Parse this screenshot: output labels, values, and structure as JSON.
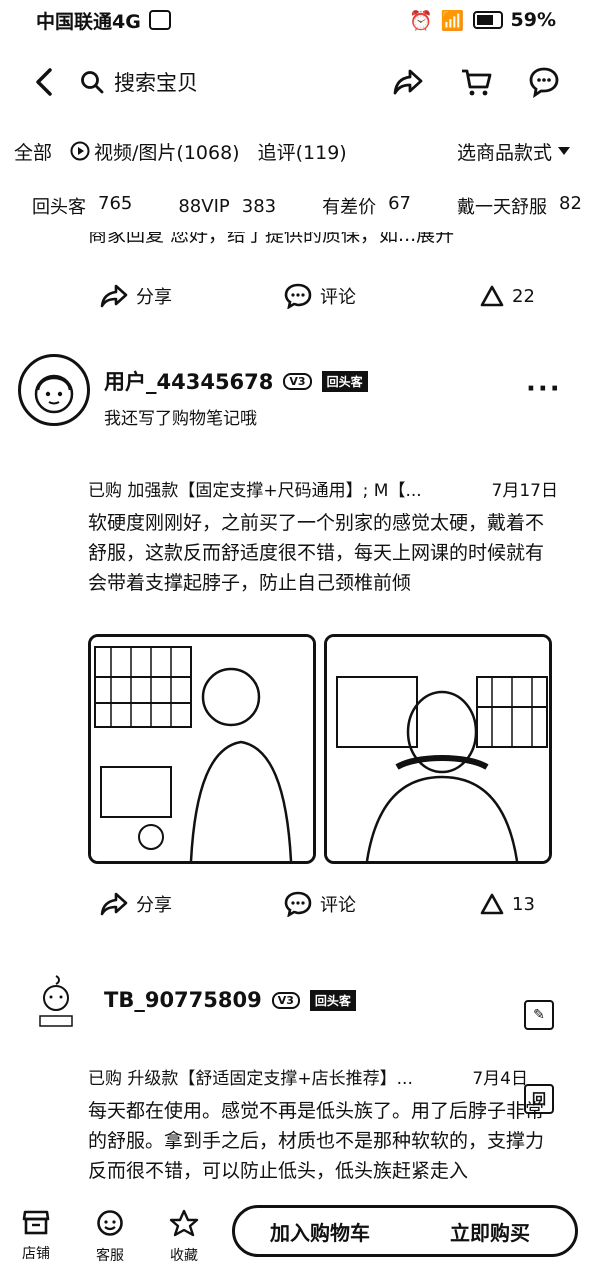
{
  "status_bar": {
    "carrier": "中国联通4G",
    "battery": "59%"
  },
  "nav": {
    "search_text": "搜索宝贝"
  },
  "filters": {
    "all": "全部",
    "media": "视频/图片(1068)",
    "followup": "追评(119)",
    "style": "选商品款式"
  },
  "tags": [
    {
      "label": "回头客",
      "count": "765"
    },
    {
      "label": "88VIP",
      "count": "383"
    },
    {
      "label": "有差价",
      "count": "67"
    },
    {
      "label": "戴一天舒服",
      "count": "82"
    }
  ],
  "cut_text": "商家回复 您好，给了提供的质保，如...展开",
  "action_labels": {
    "share": "分享",
    "comment": "评论"
  },
  "review_top": {
    "likes": "22"
  },
  "review_1": {
    "username": "用户_44345678",
    "vip_badge": "V3",
    "repeat_badge": "回头客",
    "subtitle": "我还写了购物笔记哦",
    "purchase": "已购 加强款【固定支撑+尺码通用】; M【...",
    "date": "7月17日",
    "text": "软硬度刚刚好，之前买了一个别家的感觉太硬，戴着不舒服，这款反而舒适度很不错，每天上网课的时候就有会带着支撑起脖子，防止自己颈椎前倾",
    "likes": "13"
  },
  "review_2": {
    "username": "TB_90775809",
    "vip_badge": "V3",
    "repeat_badge": "回头客",
    "purchase": "已购 升级款【舒适固定支撑+店长推荐】...",
    "date": "7月4日",
    "text": "每天都在使用。感觉不再是低头族了。用了后脖子非常的舒服。拿到手之后，材质也不是那种软软的，支撑力反而很不错，可以防止低头，低头族赶紧走入"
  },
  "bottom_bar": {
    "shop": "店铺",
    "service": "客服",
    "favorite": "收藏",
    "add_cart": "加入购物车",
    "buy_now": "立即购买"
  }
}
